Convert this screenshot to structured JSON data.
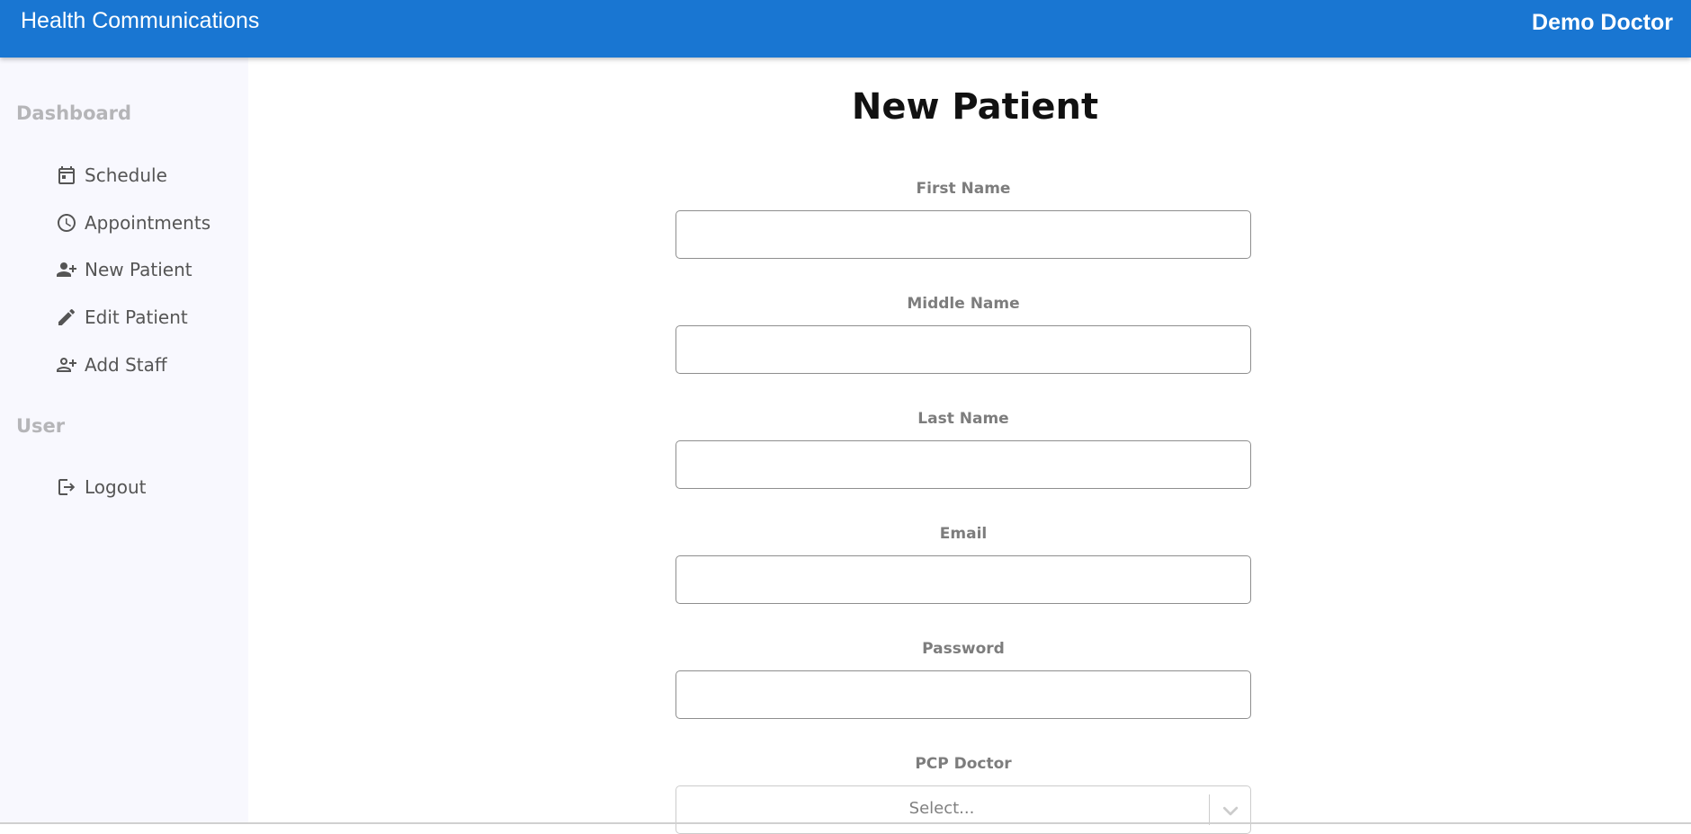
{
  "header": {
    "app_title": "Health Communications",
    "user_name": "Demo Doctor",
    "bg_color": "#1976d2"
  },
  "sidebar": {
    "sections": [
      {
        "title": "Dashboard",
        "items": [
          {
            "label": "Schedule",
            "icon": "calendar-icon"
          },
          {
            "label": "Appointments",
            "icon": "clock-icon"
          },
          {
            "label": "New Patient",
            "icon": "person-add-icon"
          },
          {
            "label": "Edit Patient",
            "icon": "pencil-icon"
          },
          {
            "label": "Add Staff",
            "icon": "person-add-outline-icon"
          }
        ]
      },
      {
        "title": "User",
        "items": [
          {
            "label": "Logout",
            "icon": "logout-icon"
          }
        ]
      }
    ]
  },
  "form": {
    "title": "New Patient",
    "fields": [
      {
        "label": "First Name",
        "value": "",
        "type": "text"
      },
      {
        "label": "Middle Name",
        "value": "",
        "type": "text"
      },
      {
        "label": "Last Name",
        "value": "",
        "type": "text"
      },
      {
        "label": "Email",
        "value": "",
        "type": "email"
      },
      {
        "label": "Password",
        "value": "",
        "type": "password"
      }
    ],
    "pcp_doctor": {
      "label": "PCP Doctor",
      "placeholder": "Select..."
    }
  }
}
